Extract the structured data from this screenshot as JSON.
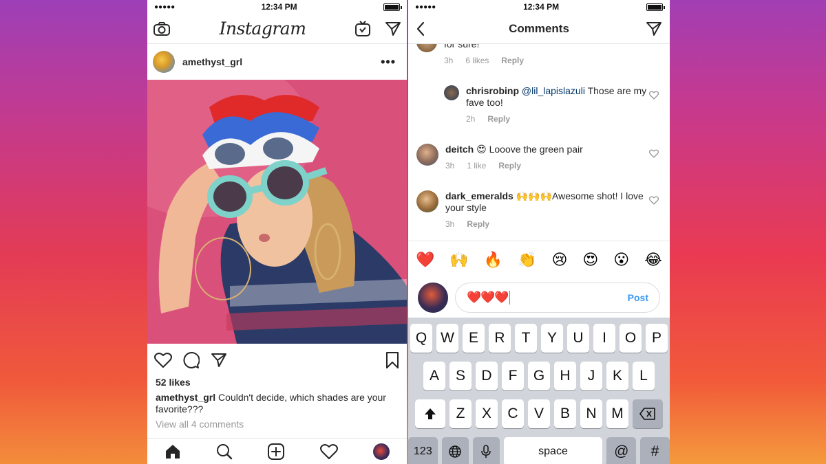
{
  "phone_left": {
    "status": {
      "signal": "●●●●●",
      "time": "12:34 PM"
    },
    "header": {
      "logo": "Instagram"
    },
    "post": {
      "username": "amethyst_grl",
      "more": "•••",
      "likes": "52 likes",
      "caption_user": "amethyst_grl",
      "caption_text": "Couldn't decide, which shades are your favorite???",
      "view_all": "View all 4 comments"
    }
  },
  "phone_right": {
    "status": {
      "signal": "●●●●●",
      "time": "12:34 PM"
    },
    "header": {
      "title": "Comments"
    },
    "partial_comment": {
      "text": "for sure!",
      "time": "3h",
      "likes": "6 likes",
      "reply": "Reply"
    },
    "comments": [
      {
        "user": "chrisrobinp",
        "mention": "@lil_lapislazuli",
        "text": "Those are my fave too!",
        "time": "2h",
        "likes": "",
        "reply": "Reply"
      },
      {
        "user": "deitch",
        "text": "😍 Looove the green pair",
        "time": "3h",
        "likes": "1 like",
        "reply": "Reply"
      },
      {
        "user": "dark_emeralds",
        "text": "🙌🙌🙌Awesome shot! I love your style",
        "time": "3h",
        "likes": "",
        "reply": "Reply"
      }
    ],
    "emoji_bar": [
      "❤️",
      "🙌",
      "🔥",
      "👏",
      "😢",
      "😍",
      "😮",
      "😂"
    ],
    "input": {
      "value": "❤️❤️❤️",
      "post_label": "Post"
    },
    "keyboard": {
      "row1": [
        "Q",
        "W",
        "E",
        "R",
        "T",
        "Y",
        "U",
        "I",
        "O",
        "P"
      ],
      "row2": [
        "A",
        "S",
        "D",
        "F",
        "G",
        "H",
        "J",
        "K",
        "L"
      ],
      "row3": [
        "Z",
        "X",
        "C",
        "V",
        "B",
        "N",
        "M"
      ],
      "numbers": "123",
      "space": "space",
      "at": "@",
      "hash": "#"
    }
  }
}
